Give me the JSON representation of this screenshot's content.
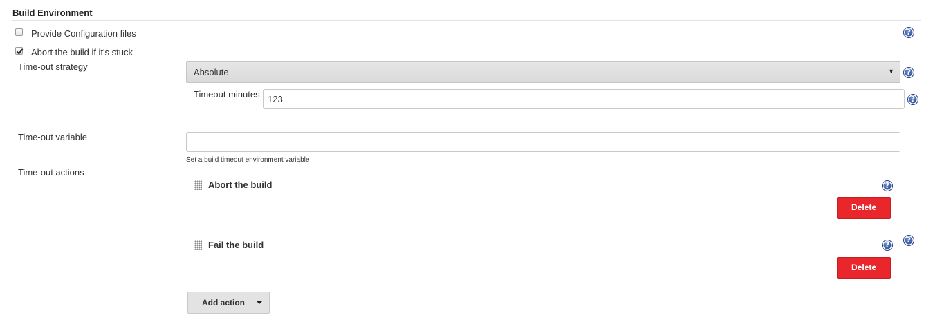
{
  "section": {
    "title": "Build Environment"
  },
  "options": {
    "provide_config": {
      "label": "Provide Configuration files",
      "checked": false
    },
    "abort_if_stuck": {
      "label": "Abort the build if it's stuck",
      "checked": true
    }
  },
  "timeout_strategy": {
    "label": "Time-out strategy",
    "selected": "Absolute"
  },
  "timeout_minutes": {
    "label": "Timeout minutes",
    "value": "123"
  },
  "timeout_variable": {
    "label": "Time-out variable",
    "value": "",
    "hint": "Set a build timeout environment variable"
  },
  "timeout_actions": {
    "label": "Time-out actions",
    "items": [
      {
        "title": "Abort the build",
        "delete_label": "Delete"
      },
      {
        "title": "Fail the build",
        "delete_label": "Delete"
      }
    ],
    "add_label": "Add action"
  },
  "help": {
    "glyph": "?"
  },
  "colors": {
    "delete": "#e8262b",
    "help": "#2c4d9a"
  }
}
